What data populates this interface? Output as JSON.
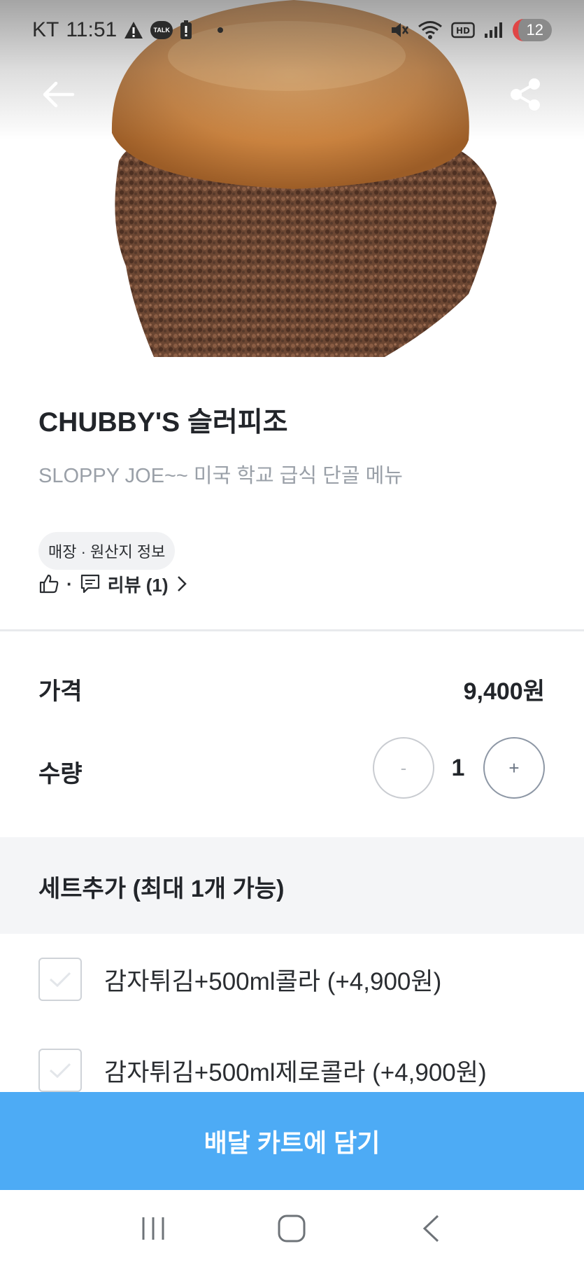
{
  "status_bar": {
    "carrier": "KT",
    "time": "11:51",
    "talk_icon_label": "TALK",
    "notification_count": "12",
    "icons": [
      "warning-icon",
      "talk-icon",
      "battery-alert-icon",
      "dot-icon",
      "mute-icon",
      "wifi-icon",
      "hd-icon",
      "signal-icon"
    ]
  },
  "header": {
    "back_icon": "arrow-left-icon",
    "share_icon": "share-icon"
  },
  "product": {
    "title": "CHUBBY'S 슬러피조",
    "description": "SLOPPY JOE~~ 미국 학교 급식 단골 메뉴",
    "info_chip": "매장 · 원산지 정보",
    "like_separator": "·",
    "review_label": "리뷰 (1)"
  },
  "price": {
    "label": "가격",
    "value": "9,400원"
  },
  "quantity": {
    "label": "수량",
    "minus": "-",
    "value": "1",
    "plus": "+"
  },
  "set_options": {
    "title": "세트추가 (최대 1개 가능)",
    "options": [
      {
        "label": "감자튀김+500ml콜라 (+4,900원)",
        "checked": false
      },
      {
        "label": "감자튀김+500ml제로콜라 (+4,900원)",
        "checked": false
      }
    ]
  },
  "cta": {
    "label": "배달 카트에 담기",
    "color": "#4dabf5"
  },
  "system_nav": {
    "icons": [
      "recent-apps-icon",
      "home-icon",
      "back-icon"
    ]
  }
}
